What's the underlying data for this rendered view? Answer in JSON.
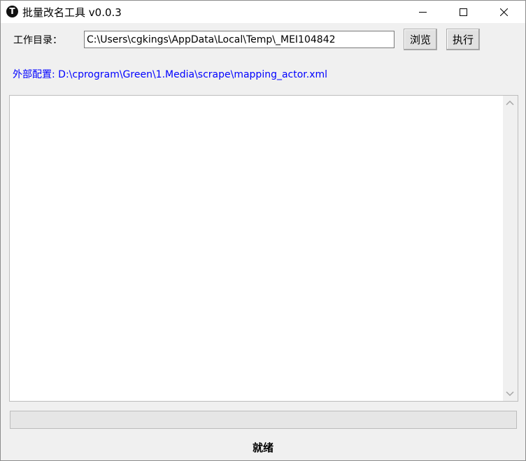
{
  "window": {
    "title": "批量改名工具 v0.0.3",
    "app_icon_glyph": "T"
  },
  "toolbar": {
    "working_dir_label": "工作目录：",
    "working_dir_value": "C:\\Users\\cgkings\\AppData\\Local\\Temp\\_MEI104842",
    "browse_label": "浏览",
    "execute_label": "执行"
  },
  "config": {
    "external_config_text": "外部配置: D:\\cprogram\\Green\\1.Media\\scrape\\mapping_actor.xml"
  },
  "log": {
    "content": ""
  },
  "progress": {
    "value_percent": 0
  },
  "status": {
    "text": "就绪"
  },
  "icons": {
    "app": "app-logo-icon",
    "minimize": "minimize-icon",
    "maximize": "maximize-icon",
    "close": "close-icon",
    "scroll_up": "chevron-up-icon",
    "scroll_down": "chevron-down-icon"
  },
  "colors": {
    "config_link": "#0000ff",
    "window_bg": "#f0f0f0",
    "progress_fill": "#06b025"
  }
}
